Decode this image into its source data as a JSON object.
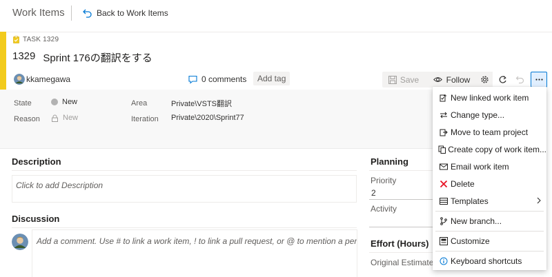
{
  "topbar": {
    "title": "Work Items",
    "back_label": "Back to Work Items"
  },
  "work_item": {
    "type_label": "TASK 1329",
    "id": "1329",
    "title": "Sprint 176の翻訳をする",
    "assignee": "kkamegawa",
    "comments_label": "0 comments",
    "add_tag_label": "Add tag"
  },
  "toolbar": {
    "save_label": "Save",
    "follow_label": "Follow"
  },
  "fields": {
    "state_label": "State",
    "state_value": "New",
    "reason_label": "Reason",
    "reason_value": "New",
    "area_label": "Area",
    "area_value": "Private\\VSTS翻訳",
    "iteration_label": "Iteration",
    "iteration_value": "Private\\2020\\Sprint77"
  },
  "description": {
    "heading": "Description",
    "placeholder": "Click to add Description"
  },
  "discussion": {
    "heading": "Discussion",
    "placeholder": "Add a comment. Use # to link a work item, ! to link a pull request, or @ to mention a person."
  },
  "planning": {
    "heading": "Planning",
    "priority_label": "Priority",
    "priority_value": "2",
    "activity_label": "Activity",
    "activity_value": ""
  },
  "effort": {
    "heading": "Effort (Hours)",
    "original_estimate_label": "Original Estimate"
  },
  "menu": {
    "items": [
      {
        "label": "New linked work item",
        "icon": "new-linked-icon"
      },
      {
        "label": "Change type...",
        "icon": "change-type-icon"
      },
      {
        "label": "Move to team project",
        "icon": "move-icon"
      },
      {
        "label": "Create copy of work item...",
        "icon": "copy-icon"
      },
      {
        "label": "Email work item",
        "icon": "mail-icon"
      },
      {
        "label": "Delete",
        "icon": "delete-icon"
      },
      {
        "label": "Templates",
        "icon": "templates-icon"
      },
      {
        "label": "New branch...",
        "icon": "branch-icon"
      },
      {
        "label": "Customize",
        "icon": "customize-icon"
      },
      {
        "label": "Keyboard shortcuts",
        "icon": "info-icon"
      }
    ]
  },
  "colors": {
    "task_accent": "#f2cb1d",
    "delete_icon": "#e81123",
    "link_blue": "#0078d4"
  }
}
